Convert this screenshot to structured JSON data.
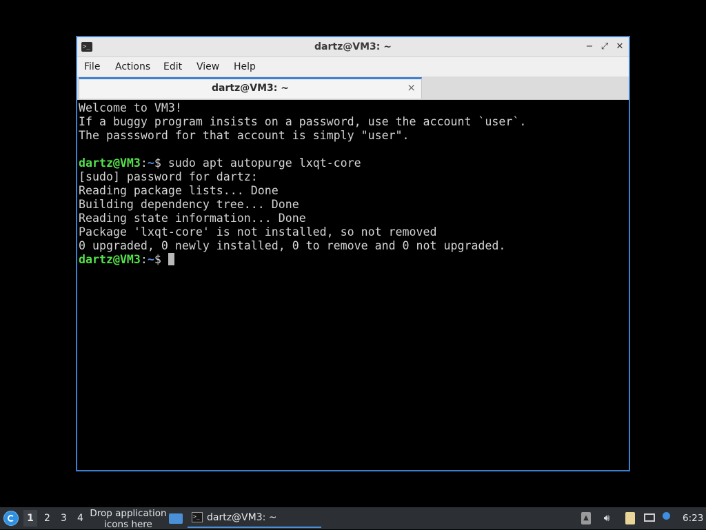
{
  "window": {
    "title": "dartz@VM3: ~",
    "controls": {
      "minimize": "−",
      "maximize": "⤢",
      "close": "✕"
    }
  },
  "menu": {
    "file": "File",
    "actions": "Actions",
    "edit": "Edit",
    "view": "View",
    "help": "Help"
  },
  "tab": {
    "label": "dartz@VM3: ~",
    "close": "×"
  },
  "terminal": {
    "lines": [
      "Welcome to VM3!",
      "If a buggy program insists on a password, use the account `user`.",
      "The passsword for that account is simply \"user\".",
      "",
      "",
      "[sudo] password for dartz:",
      "Reading package lists... Done",
      "Building dependency tree... Done",
      "Reading state information... Done",
      "Package 'lxqt-core' is not installed, so not removed",
      "0 upgraded, 0 newly installed, 0 to remove and 0 not upgraded."
    ],
    "prompt": {
      "user_host": "dartz@VM3",
      "sep": ":",
      "path": "~",
      "symbol": "$ "
    },
    "command": "sudo apt autopurge lxqt-core"
  },
  "taskbar": {
    "desktops": [
      "1",
      "2",
      "3",
      "4"
    ],
    "quicklaunch_line1": "Drop application",
    "quicklaunch_line2": "icons here",
    "task_label": "dartz@VM3: ~",
    "clock": "6:23"
  },
  "colors": {
    "accent": "#3d7fd0",
    "prompt_user": "#55e14a",
    "prompt_path": "#5c8ed6",
    "terminal_bg": "#000000",
    "taskbar_bg": "#2c3035"
  },
  "icons": {
    "window_app": "terminal-icon",
    "start": "lxqt-start-icon",
    "desktop": "show-desktop-icon",
    "task": "terminal-icon",
    "tray": [
      "tray-arrow-up-icon",
      "volume-icon",
      "clipboard-icon",
      "network-icon",
      "notification-icon"
    ]
  }
}
